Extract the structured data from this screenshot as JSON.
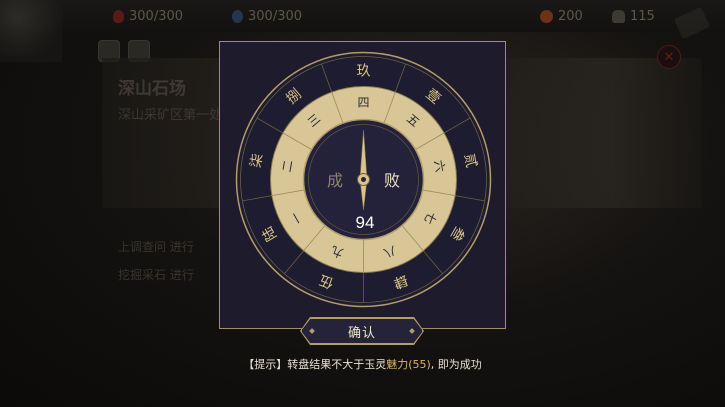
{
  "topbar": {
    "hp": "300/300",
    "energy": "300/300",
    "gems": "200",
    "bag": "115"
  },
  "background": {
    "close_glyph": "✕",
    "stage_title": "深山石场",
    "stage_subtitle": "深山采矿区第一处",
    "task1": "上调查问 进行",
    "task2": "挖掘采石 进行"
  },
  "wheel": {
    "outer_numbers": [
      "玖",
      "壹",
      "贰",
      "叁",
      "肆",
      "伍",
      "陆",
      "柒",
      "捌"
    ],
    "inner_numbers": [
      "四",
      "五",
      "六",
      "七",
      "八",
      "九",
      "一",
      "二",
      "三"
    ],
    "fail_label": "成",
    "success_label": "败",
    "result": "94"
  },
  "dialog": {
    "confirm_label": "确认"
  },
  "hint": {
    "prefix": "【提示】转盘结果不大于玉灵",
    "highlight": "魅力(55)",
    "suffix": ", 即为成功"
  },
  "colors": {
    "panel": "#1d1b2c",
    "gold": "#a38f5e",
    "ring_light": "#d8c697",
    "ring_dark": "#24223a"
  }
}
